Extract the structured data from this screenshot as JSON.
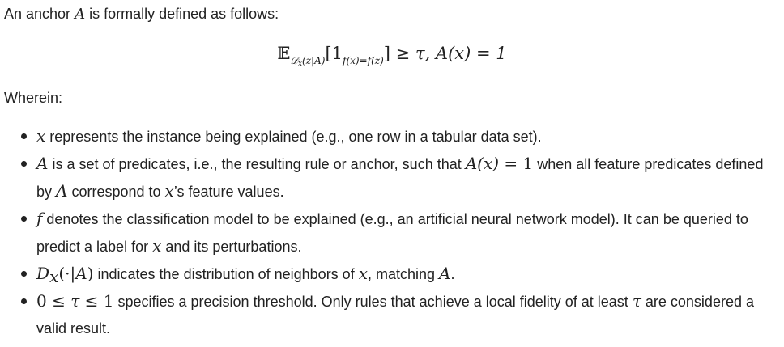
{
  "intro": {
    "before": "An anchor ",
    "var_a": "A",
    "after": " is formally defined as follows:"
  },
  "formula": {
    "expect": "𝔼",
    "dist": "𝒟",
    "dist_sub_x": "x",
    "dist_cond": "(z|A)",
    "bracket_open": "[",
    "indicator": "1",
    "indicator_sub": "f(x)=f(z)",
    "bracket_close": "]",
    "relation": " ≥ τ, ",
    "anchor_eq": "A(x) = 1"
  },
  "wherein": "Wherein:",
  "items": [
    {
      "m1": "x",
      "t1": " represents the instance being explained (e.g., one row in a tabular data set)."
    },
    {
      "m1": "A",
      "t1": " is a set of predicates, i.e., the resulting rule or anchor, such that ",
      "m2": "A(x)",
      "r2": " = 1",
      "t2": " when all feature predicates defined by ",
      "m3": "A",
      "t3": " correspond to ",
      "m4": "x",
      "t4": "’s feature values."
    },
    {
      "m1": "f",
      "t1": " denotes the classification model to be explained (e.g., an artificial neural network model). It can be queried to predict a label for ",
      "m2": "x",
      "t2": " and its perturbations."
    },
    {
      "m1": "D",
      "m1_sub": "x",
      "r1": "(·|",
      "m1b": "A",
      "r1b": ")",
      "t1": " indicates the distribution of neighbors of ",
      "m2": "x",
      "t2": ", matching ",
      "m3": "A",
      "t3": "."
    },
    {
      "r1": "0 ≤ ",
      "m1": "τ",
      "r1b": " ≤ 1",
      "t1": " specifies a precision threshold. Only rules that achieve a local fidelity of at least ",
      "m2": "τ",
      "t2": " are considered a valid result."
    }
  ]
}
